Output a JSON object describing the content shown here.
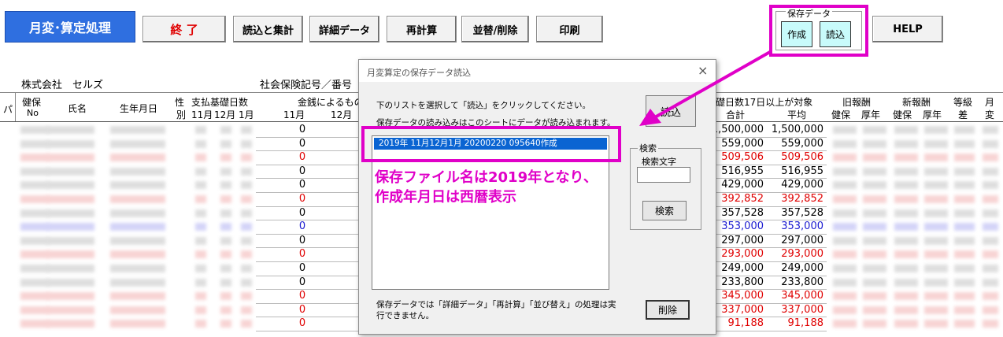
{
  "toolbar": {
    "monthly_label": "月変･算定処理",
    "end_label": "終 了",
    "load_sum_label": "読込と集計",
    "detail_label": "詳細データ",
    "recalc_label": "再計算",
    "sort_delete_label": "並替/削除",
    "print_label": "印刷",
    "save_group_label": "保存データ",
    "create_label": "作成",
    "load_label": "読込",
    "help_label": "HELP"
  },
  "sheet": {
    "company": "株式会社　セルズ",
    "insurance_label": "社会保険記号／番号",
    "headers": {
      "pa": "パ",
      "kenpo": "健保",
      "no": "No",
      "name": "氏名",
      "birth": "生年月日",
      "sex_top": "性",
      "sex_bottom": "別",
      "basic_days": "支払基礎日数",
      "m11": "11月",
      "m12": "12月",
      "m1": "1月",
      "kinsen": "金銭によるもの",
      "k11": "11月",
      "k12": "12月",
      "over17": "基礎日数17日以上が対象",
      "total": "合計",
      "avg": "平均",
      "old_pay": "旧報酬",
      "old_kenpo": "健保",
      "old_kounen": "厚年",
      "new_pay": "新報酬",
      "new_kenpo": "健保",
      "new_kounen": "厚年",
      "grade": "等級",
      "diff": "差",
      "month": "月",
      "change": "変"
    },
    "rows": [
      {
        "zero": "0",
        "total": "1,500,000",
        "avg": "1,500,000",
        "color": "#000000"
      },
      {
        "zero": "0",
        "total": "559,000",
        "avg": "559,000",
        "color": "#000000"
      },
      {
        "zero": "0",
        "total": "509,506",
        "avg": "509,506",
        "color": "#e00000"
      },
      {
        "zero": "0",
        "total": "516,955",
        "avg": "516,955",
        "color": "#000000"
      },
      {
        "zero": "0",
        "total": "429,000",
        "avg": "429,000",
        "color": "#000000"
      },
      {
        "zero": "0",
        "total": "392,852",
        "avg": "392,852",
        "color": "#e00000"
      },
      {
        "zero": "0",
        "total": "357,528",
        "avg": "357,528",
        "color": "#000000"
      },
      {
        "zero": "0",
        "total": "353,000",
        "avg": "353,000",
        "color": "#1a1ad0"
      },
      {
        "zero": "0",
        "total": "297,000",
        "avg": "297,000",
        "color": "#000000"
      },
      {
        "zero": "0",
        "total": "293,000",
        "avg": "293,000",
        "color": "#e00000"
      },
      {
        "zero": "0",
        "total": "249,000",
        "avg": "249,000",
        "color": "#000000"
      },
      {
        "zero": "0",
        "total": "233,800",
        "avg": "233,800",
        "color": "#000000"
      },
      {
        "zero": "0",
        "total": "345,000",
        "avg": "345,000",
        "color": "#e00000"
      },
      {
        "zero": "0",
        "total": "337,000",
        "avg": "337,000",
        "color": "#e00000"
      },
      {
        "zero": "0",
        "total": "91,188",
        "avg": "91,188",
        "color": "#e00000"
      }
    ]
  },
  "dialog": {
    "title": "月変算定の保存データ読込",
    "instruction1": "下のリストを選択して「読込」をクリックしてください。",
    "instruction2": "保存データの読み込みはこのシートにデータが読み込まれます。",
    "selected_item": "2019年 11月12月1月  20200220 095640作成",
    "load_button": "読込",
    "search_group": "検索",
    "search_text_label": "検索文字",
    "search_input_value": "",
    "search_button": "検索",
    "delete_button": "削除",
    "footer_note_line1": "保存データでは「詳細データ」「再計算」「並び替え」の処理は実",
    "footer_note_line2": "行できません。",
    "close_glyph": "×"
  },
  "annotation": {
    "line1": "保存ファイル名は2019年となり、",
    "line2": "作成年月日は西暦表示",
    "color": "#e000c8"
  }
}
